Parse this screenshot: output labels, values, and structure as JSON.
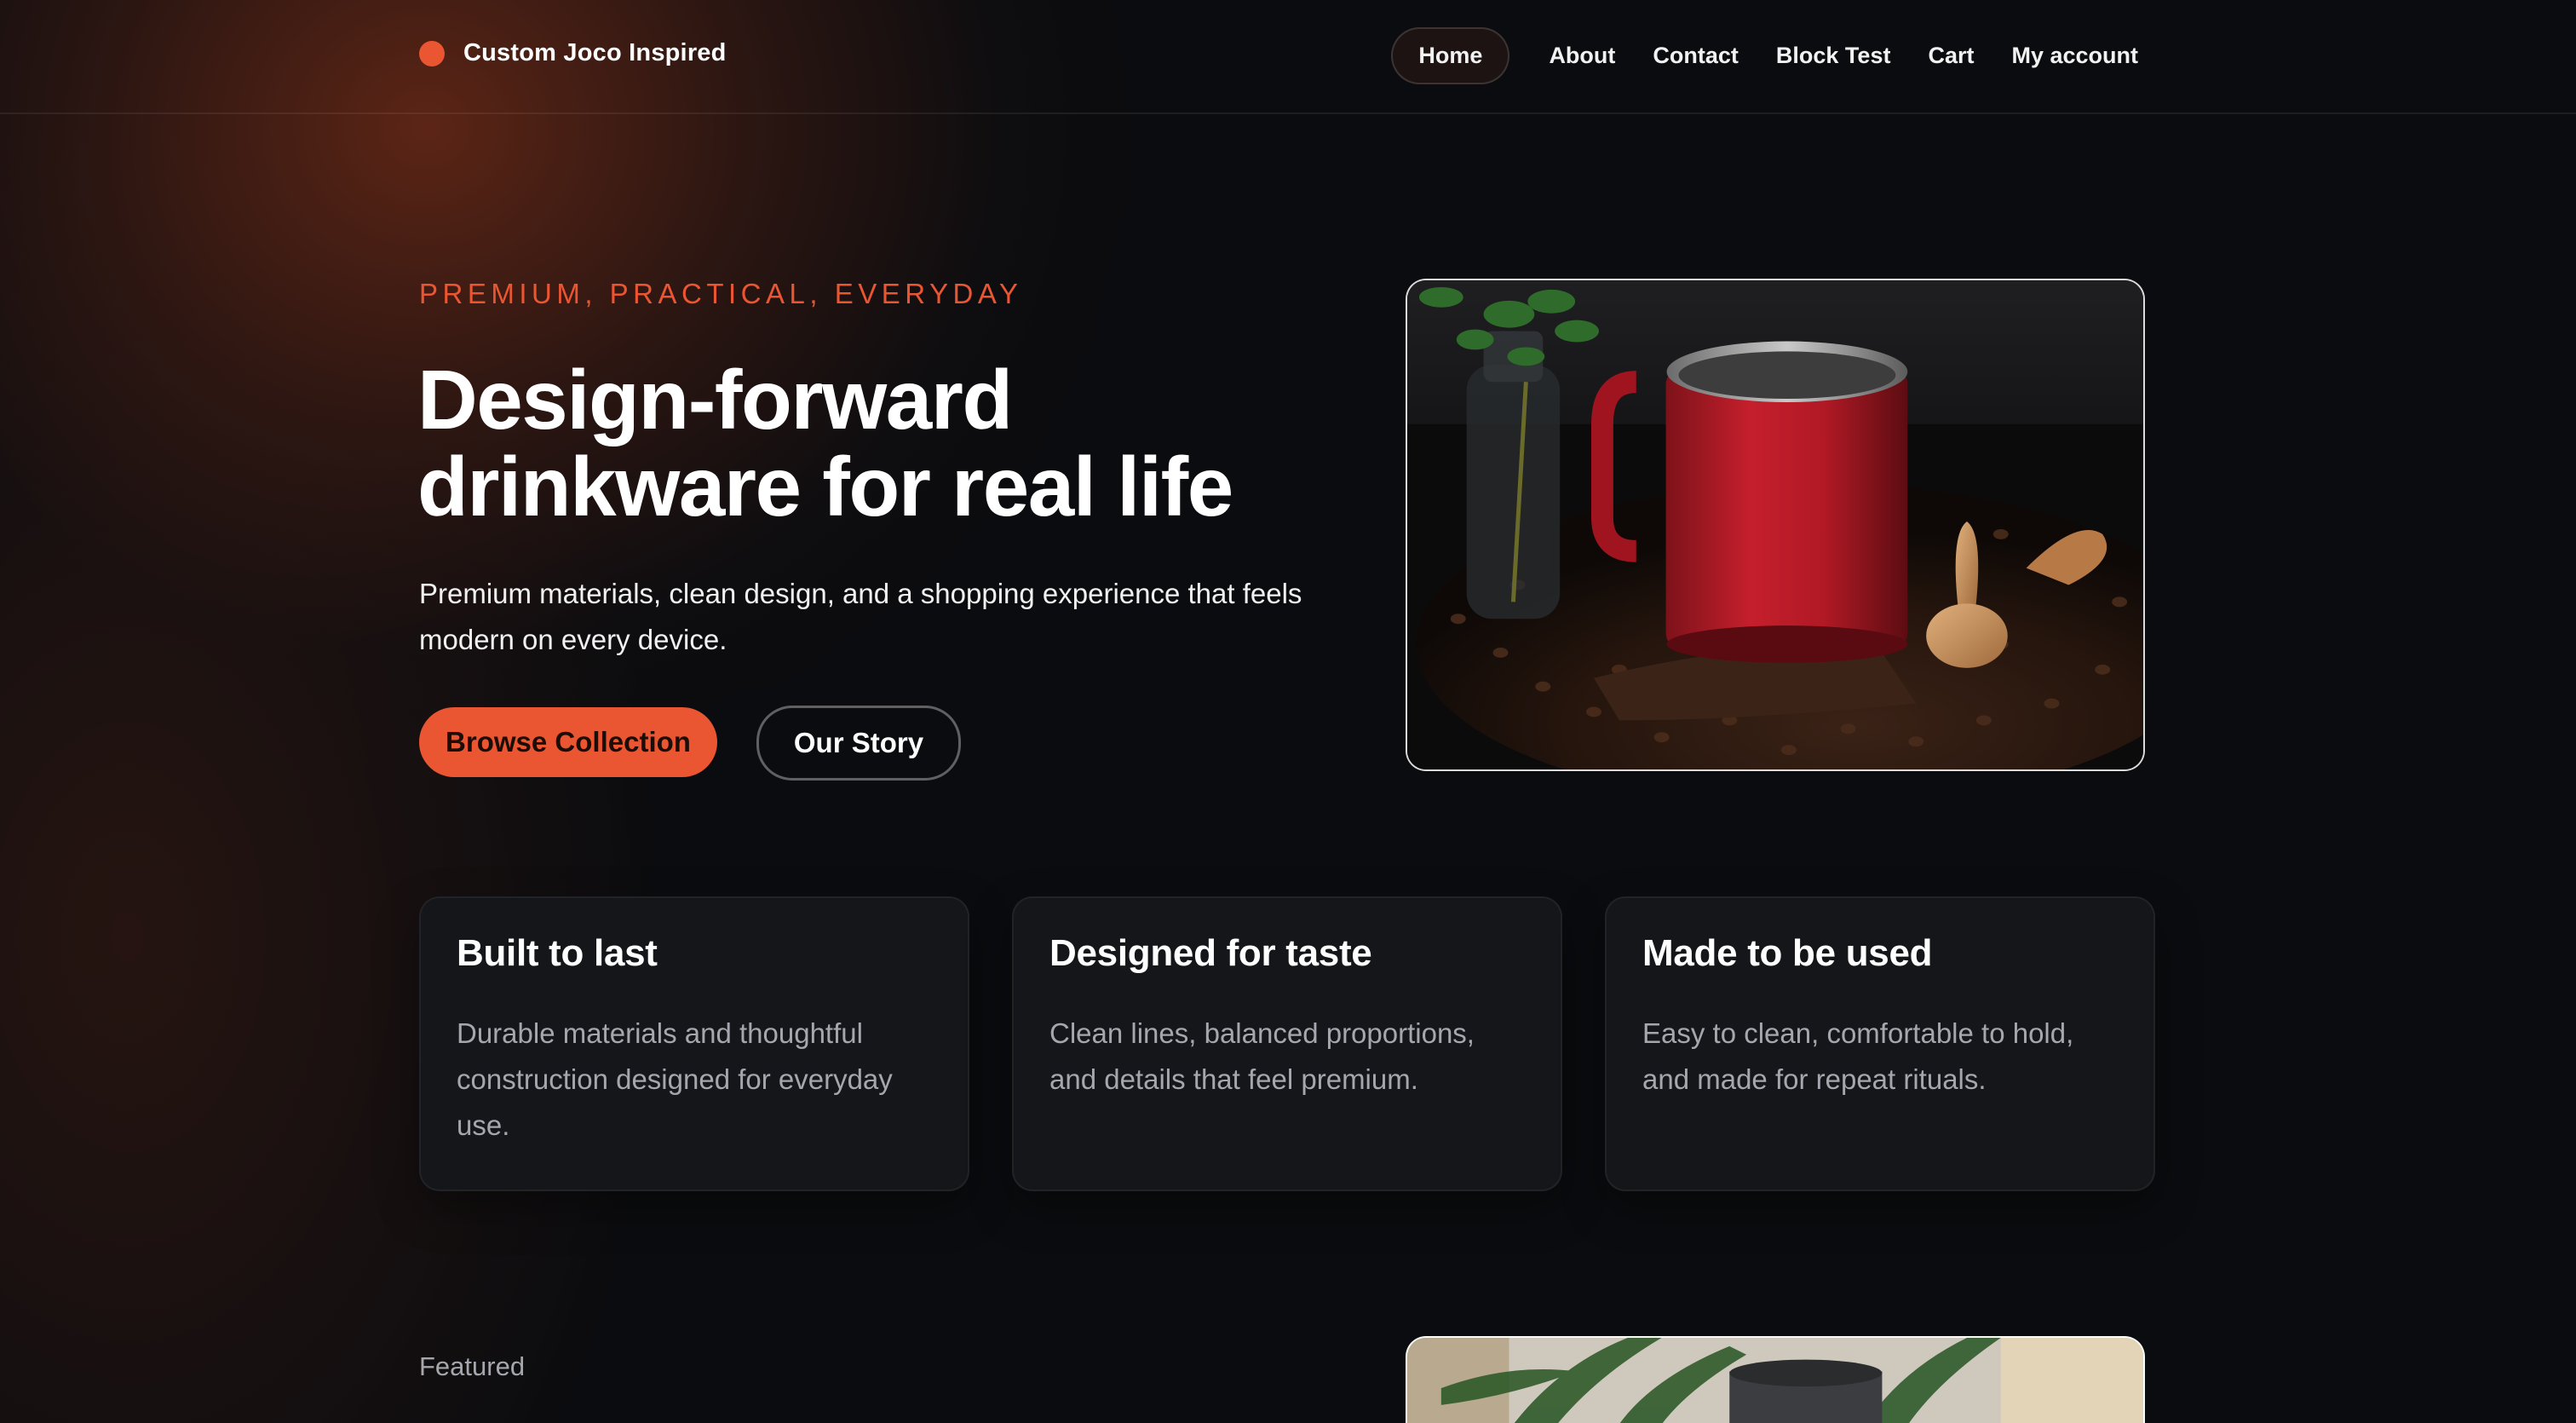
{
  "brand": {
    "name": "Custom Joco Inspired",
    "accent": "#ea5532"
  },
  "nav": {
    "items": [
      {
        "label": "Home",
        "active": true
      },
      {
        "label": "About"
      },
      {
        "label": "Contact"
      },
      {
        "label": "Block Test"
      },
      {
        "label": "Cart"
      },
      {
        "label": "My account"
      }
    ]
  },
  "hero": {
    "eyebrow": "PREMIUM, PRACTICAL, EVERYDAY",
    "title_line1": "Design-forward",
    "title_line2": "drinkware for real life",
    "subtitle": "Premium materials, clean design, and a shopping experience that feels modern on every device.",
    "primary_button": "Browse Collection",
    "secondary_button": "Our Story"
  },
  "features": [
    {
      "title": "Built to last",
      "text": "Durable materials and thoughtful construction designed for everyday use."
    },
    {
      "title": "Designed for taste",
      "text": "Clean lines, balanced proportions, and details that feel premium."
    },
    {
      "title": "Made to be used",
      "text": "Easy to clean, comfortable to hold, and made for repeat rituals."
    }
  ],
  "featured": {
    "label": "Featured"
  }
}
